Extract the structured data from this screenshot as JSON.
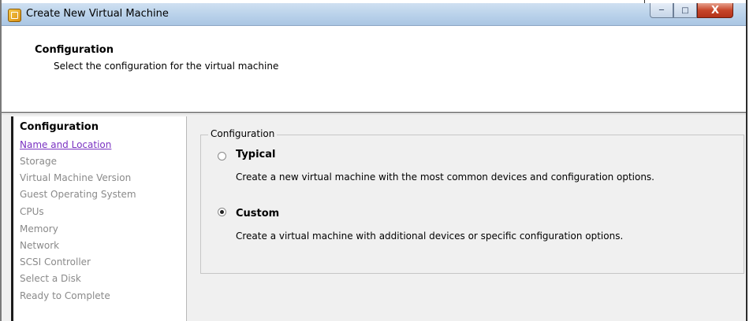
{
  "window": {
    "title": "Create New Virtual Machine",
    "controls": {
      "minimize_icon": "minimize-icon",
      "maximize_icon": "maximize-icon",
      "close_icon": "close-icon",
      "close_glyph": "X"
    }
  },
  "header": {
    "title": "Configuration",
    "subtitle": "Select the configuration for the virtual machine"
  },
  "sidebar": {
    "items": [
      {
        "label": "Configuration",
        "state": "current"
      },
      {
        "label": "Name and Location",
        "state": "link"
      },
      {
        "label": "Storage",
        "state": "disabled"
      },
      {
        "label": "Virtual Machine Version",
        "state": "disabled"
      },
      {
        "label": "Guest Operating System",
        "state": "disabled"
      },
      {
        "label": "CPUs",
        "state": "disabled"
      },
      {
        "label": "Memory",
        "state": "disabled"
      },
      {
        "label": "Network",
        "state": "disabled"
      },
      {
        "label": "SCSI Controller",
        "state": "disabled"
      },
      {
        "label": "Select a Disk",
        "state": "disabled"
      },
      {
        "label": "Ready to Complete",
        "state": "disabled"
      }
    ]
  },
  "configuration_group": {
    "legend": "Configuration",
    "options": [
      {
        "label": "Typical",
        "description": "Create a new virtual machine with the most common devices and configuration options.",
        "selected": false
      },
      {
        "label": "Custom",
        "description": "Create a virtual machine with additional devices or specific configuration options.",
        "selected": true
      }
    ]
  },
  "colors": {
    "link": "#7a32c2",
    "disabled_text": "#8a8a8a",
    "titlebar": "#b9d1ea",
    "close_button": "#c7462a"
  }
}
